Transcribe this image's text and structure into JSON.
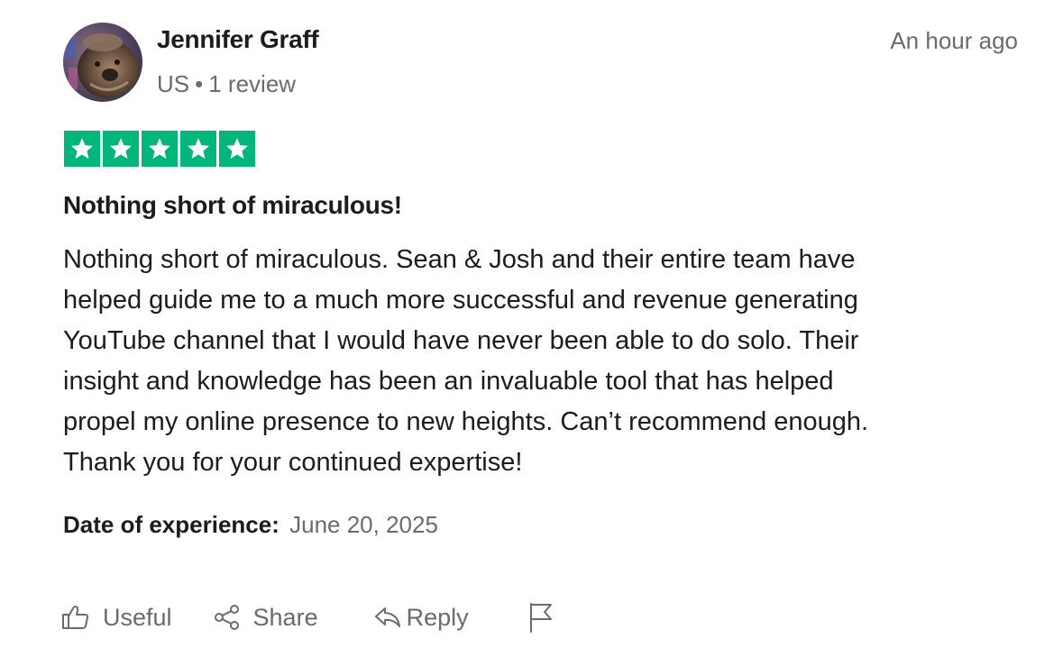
{
  "reviewer": {
    "name": "Jennifer Graff",
    "country": "US",
    "separator": "•",
    "review_count": "1 review",
    "avatar_icon": "user-photo-avatar"
  },
  "timestamp": "An hour ago",
  "rating": {
    "stars": 5,
    "out_of": 5,
    "star_color": "#00b67a"
  },
  "review": {
    "title": "Nothing short of miraculous!",
    "body_lines": [
      "Nothing short of miraculous. Sean & Josh and their entire team have",
      "helped guide me to a much more successful and revenue generating",
      "YouTube channel that I would have never been able to do solo. Their",
      "insight and knowledge has been an invaluable tool that has helped",
      "propel my online presence to new heights. Can’t recommend enough.",
      "Thank you for your continued expertise!"
    ]
  },
  "experience": {
    "label": "Date of experience:",
    "date": "June 20, 2025"
  },
  "actions": {
    "useful_label": "Useful",
    "useful_icon": "thumbs-up-icon",
    "share_label": "Share",
    "share_icon": "share-icon",
    "reply_label": "Reply",
    "reply_icon": "reply-icon",
    "report_icon": "flag-icon"
  }
}
